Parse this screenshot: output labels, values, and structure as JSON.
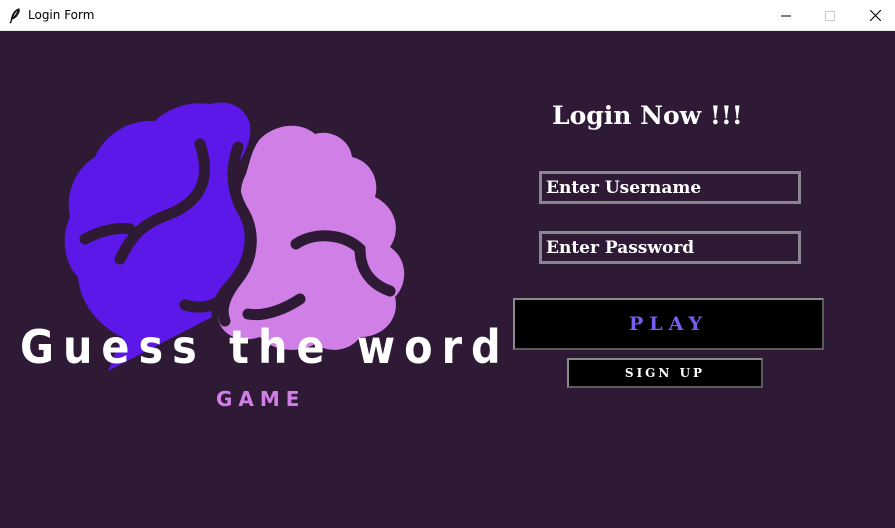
{
  "window": {
    "title": "Login Form",
    "app_icon": "feather-icon"
  },
  "logo": {
    "title": "Guess the word",
    "subtitle": "GAME",
    "colors": {
      "brain_left": "#5b18e8",
      "brain_right": "#d07fe6",
      "subtitle": "#d07fe6"
    }
  },
  "form": {
    "heading": "Login Now !!!",
    "username_placeholder": "Enter Username",
    "password_placeholder": "Enter Password",
    "play_label": "PLAY",
    "signup_label": "SIGN UP"
  },
  "theme": {
    "background": "#2e1a35",
    "play_text": "#7a5cf0",
    "button_bg": "#000000"
  }
}
